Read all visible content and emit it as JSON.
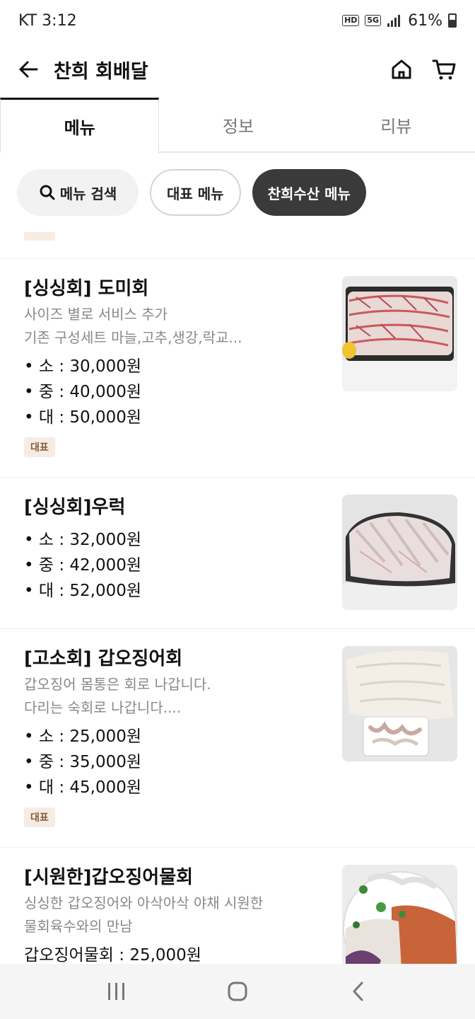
{
  "status": {
    "carrier": "KT",
    "time": "3:12",
    "hd": "HD",
    "network": "5G",
    "battery": "61%"
  },
  "app_bar": {
    "title": "찬희 회배달"
  },
  "tabs": [
    {
      "label": "메뉴",
      "active": true
    },
    {
      "label": "정보",
      "active": false
    },
    {
      "label": "리뷰",
      "active": false
    }
  ],
  "chips": {
    "search": "메뉴 검색",
    "representative": "대표 메뉴",
    "chanhee": "찬희수산 메뉴"
  },
  "colors": {
    "accent_dark": "#3a3a3a",
    "badge_bg": "#f5ece4",
    "badge_text": "#8a5a3a"
  },
  "menu": [
    {
      "name": "[싱싱회] 도미회",
      "desc1": "사이즈 별로 서비스 추가",
      "desc2": "기존 구성세트 마늘,고추,생강,락교...",
      "prices": [
        "• 소 : 30,000원",
        "• 중 : 40,000원",
        "• 대 : 50,000원"
      ],
      "badge": "대표"
    },
    {
      "name": "[싱싱회]우럭",
      "prices": [
        "• 소 : 32,000원",
        "• 중 : 42,000원",
        "• 대 : 52,000원"
      ]
    },
    {
      "name": "[고소회] 갑오징어회",
      "desc1": "갑오징어 몸통은 회로 나갑니다.",
      "desc2": "다리는 숙회로 나갑니다....",
      "prices": [
        "• 소 : 25,000원",
        "• 중 : 35,000원",
        "• 대 : 45,000원"
      ],
      "badge": "대표"
    },
    {
      "name": "[시원한]갑오징어물회",
      "desc1": "싱싱한 갑오징어와 아삭아삭 야채 시원한",
      "desc2": "물회육수와의 만남",
      "prices": [
        "갑오징어물회 : 25,000원"
      ]
    }
  ]
}
